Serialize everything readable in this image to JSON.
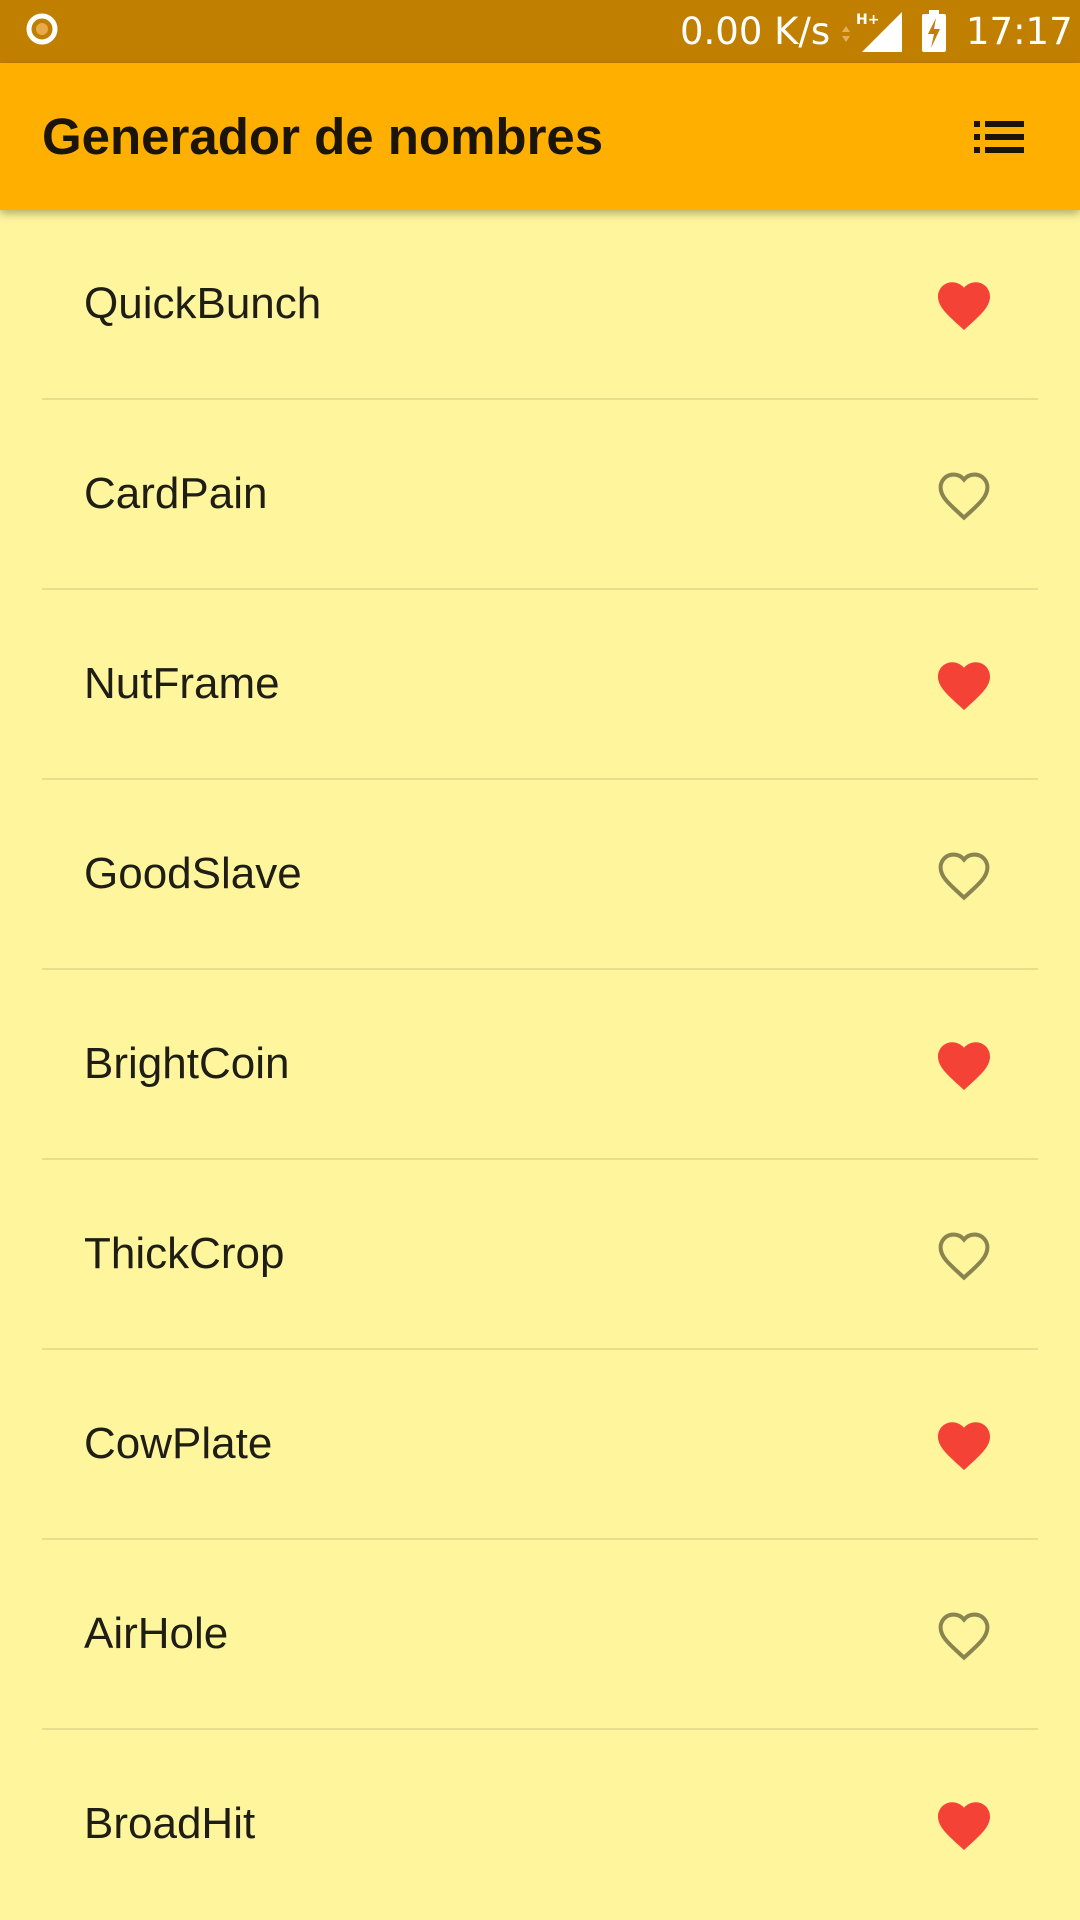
{
  "status_bar": {
    "network_speed": "0.00 K/s",
    "network_type": "H+",
    "time": "17:17"
  },
  "app_bar": {
    "title": "Generador de nombres",
    "menu_icon": "list-icon"
  },
  "colors": {
    "status_bar": "#C17F00",
    "app_bar": "#FFAF00",
    "background": "#FFF59D",
    "favorite": "#F44336",
    "not_favorite": "#8A8550",
    "divider": "#E8DE8C"
  },
  "names": [
    {
      "name": "QuickBunch",
      "favorite": true
    },
    {
      "name": "CardPain",
      "favorite": false
    },
    {
      "name": "NutFrame",
      "favorite": true
    },
    {
      "name": "GoodSlave",
      "favorite": false
    },
    {
      "name": "BrightCoin",
      "favorite": true
    },
    {
      "name": "ThickCrop",
      "favorite": false
    },
    {
      "name": "CowPlate",
      "favorite": true
    },
    {
      "name": "AirHole",
      "favorite": false
    },
    {
      "name": "BroadHit",
      "favorite": true
    }
  ]
}
